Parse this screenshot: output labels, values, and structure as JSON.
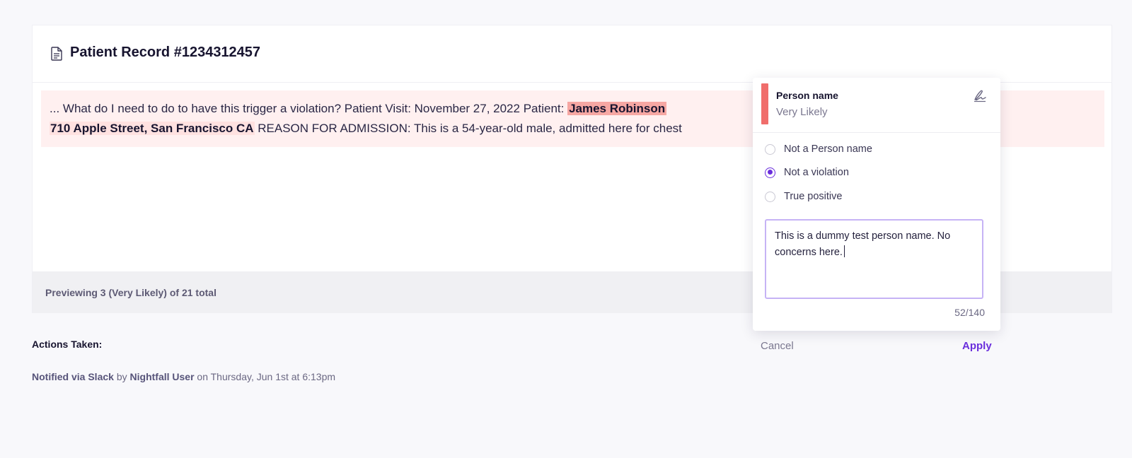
{
  "record": {
    "title": "Patient Record #1234312457",
    "icon": "document-icon"
  },
  "preview": {
    "line1_pre": "... What do I need to do to have this trigger a violation? Patient Visit: November 27, 2022 Patient: ",
    "line1_highlight": "James Robinson",
    "line1_post": " ",
    "line2_highlight": "710 Apple Street, San Francisco CA",
    "line2_post": " REASON FOR ADMISSION: This is a 54-year-old male, admitted here for chest",
    "summary": "Previewing 3 (Very Likely) of 21 total"
  },
  "actions": {
    "title": "Actions Taken:",
    "notified_prefix": "Notified via Slack",
    "by_word": " by ",
    "user": "Nightfall User",
    "timestamp": " on Thursday, Jun 1st at 6:13pm"
  },
  "popover": {
    "detector": "Person name",
    "likelihood": "Very Likely",
    "accent_color": "#f06d6b",
    "options": [
      {
        "label": "Not a Person name",
        "checked": false
      },
      {
        "label": "Not a violation",
        "checked": true
      },
      {
        "label": "True positive",
        "checked": false
      }
    ],
    "comment": "This is a dummy test person name. No concerns here.",
    "counter": "52/140",
    "cancel_label": "Cancel",
    "apply_label": "Apply",
    "accent": "#6a2edc"
  }
}
